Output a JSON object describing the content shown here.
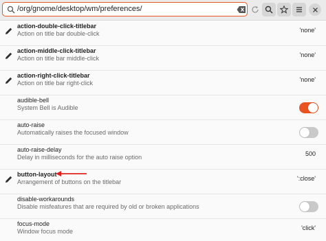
{
  "toolbar": {
    "path": "/org/gnome/desktop/wm/preferences/",
    "accent": "#e95420",
    "icons": [
      "search-icon",
      "clear-text-icon",
      "refresh-icon",
      "search-icon",
      "star-icon",
      "hamburger-menu-icon",
      "close-icon"
    ]
  },
  "rows": [
    {
      "name": "action-double-click-titlebar",
      "desc": "Action on title bar double-click",
      "value": "'none'",
      "edited": true
    },
    {
      "name": "action-middle-click-titlebar",
      "desc": "Action on title bar middle-click",
      "value": "'none'",
      "edited": true
    },
    {
      "name": "action-right-click-titlebar",
      "desc": "Action on title bar right-click",
      "value": "'none'",
      "edited": true
    },
    {
      "name": "audible-bell",
      "desc": "System Bell is Audible",
      "switch": true,
      "edited": false
    },
    {
      "name": "auto-raise",
      "desc": "Automatically raises the focused window",
      "switch": false,
      "edited": false
    },
    {
      "name": "auto-raise-delay",
      "desc": "Delay in milliseconds for the auto raise option",
      "value": "500",
      "edited": false
    },
    {
      "name": "button-layout",
      "desc": "Arrangement of buttons on the titlebar",
      "value": "':close'",
      "edited": true
    },
    {
      "name": "disable-workarounds",
      "desc": "Disable misfeatures that are required by old or broken applications",
      "switch": false,
      "edited": false
    },
    {
      "name": "focus-mode",
      "desc": "Window focus mode",
      "value": "'click'",
      "edited": false
    }
  ],
  "annotation": {
    "arrow_color": "#e0201b",
    "points_to": "button-layout"
  }
}
